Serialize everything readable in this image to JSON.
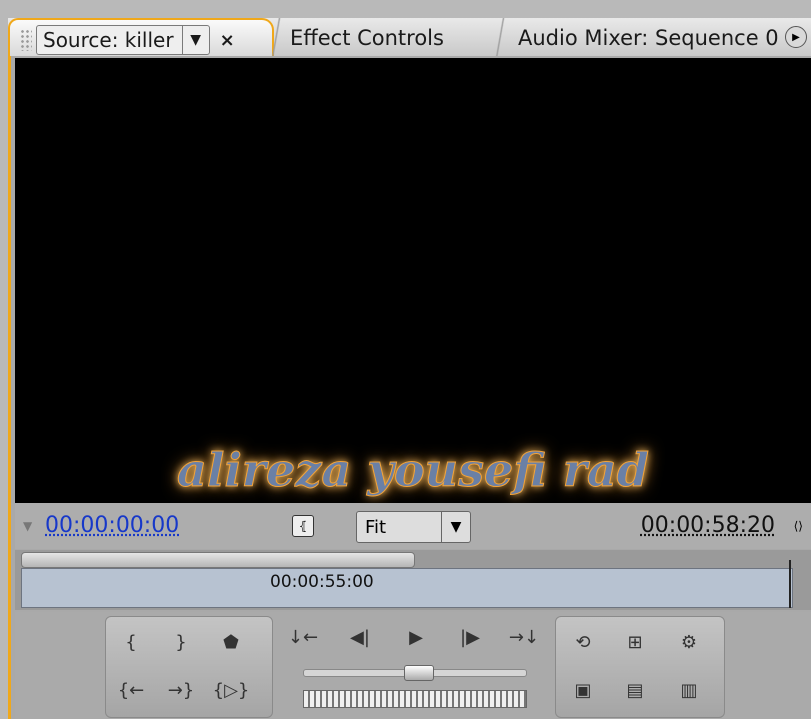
{
  "tabs": {
    "source_label": "Source: killer",
    "close_glyph": "×",
    "dropdown_glyph": "▼",
    "effect_controls": "Effect Controls",
    "audio_mixer": "Audio Mixer: Sequence 0",
    "menu_glyph": "▶"
  },
  "video": {
    "overlay_text": "alireza yousefi rad"
  },
  "timecodes": {
    "current": "00:00:00:00",
    "duration": "00:00:58:20",
    "ruler_label": "00:00:55:00"
  },
  "view": {
    "zoom_value": "Fit",
    "zoom_dropdown_glyph": "▼",
    "safe_margins_glyph": "⦃"
  },
  "controls": {
    "mark_in": "{",
    "mark_out": "}",
    "set_marker": "⬟",
    "goto_in": "{←",
    "goto_out": "→}",
    "play_in_to_out": "{▷}",
    "step_back_to_in": "↓←",
    "step_back": "◀|",
    "play": "▶",
    "step_forward": "|▶",
    "step_to_out": "→↓",
    "loop": "⟲",
    "safe_margins": "⊞",
    "output": "⚙",
    "insert": "▣",
    "overlay": "▤",
    "export_frame": "▥"
  },
  "colors": {
    "accent": "#f0a81a",
    "timecode_blue": "#1738c9",
    "track": "#b7c2d1"
  }
}
